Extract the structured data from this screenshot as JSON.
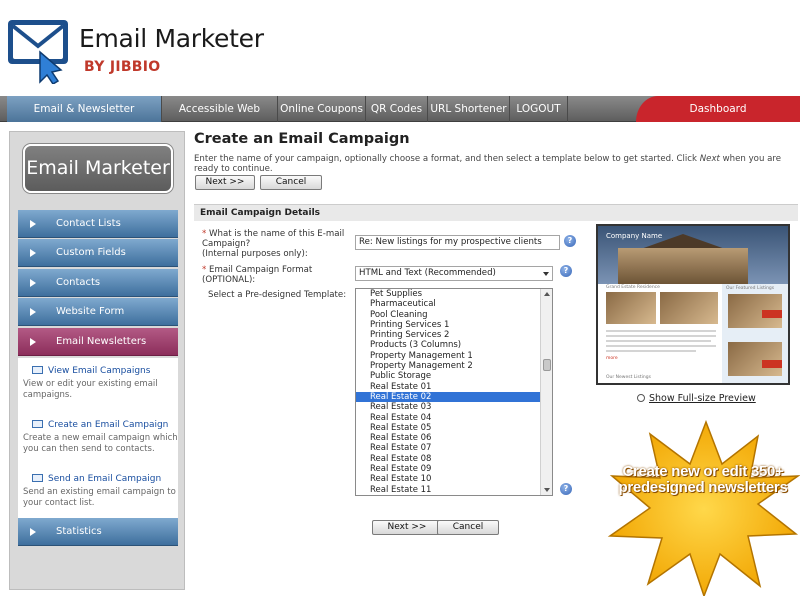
{
  "brand": {
    "title": "Email Marketer",
    "subtitle": "BY JIBBIO",
    "accent": "#c9252c"
  },
  "nav": {
    "items": [
      {
        "label": "Email & Newsletter Marketing",
        "active": true
      },
      {
        "label": "Accessible Web Forms"
      },
      {
        "label": "Online Coupons"
      },
      {
        "label": "QR Codes"
      },
      {
        "label": "URL Shortener"
      },
      {
        "label": "LOGOUT"
      }
    ],
    "dashboard": "Dashboard"
  },
  "sidebar": {
    "logo": "Email Marketer",
    "items": [
      "Contact Lists",
      "Custom Fields",
      "Contacts",
      "Website Form",
      "Email Newsletters"
    ],
    "sub": [
      {
        "label": "View Email Campaigns",
        "desc": "View or edit your existing email campaigns."
      },
      {
        "label": "Create an Email Campaign",
        "desc": "Create a new email campaign which you can then send to contacts."
      },
      {
        "label": "Send an Email Campaign",
        "desc": "Send an existing email campaign to your contact list."
      }
    ],
    "statistics": "Statistics"
  },
  "main": {
    "title": "Create an Email Campaign",
    "instructions_a": "Enter the name of your campaign, optionally choose a format, and then select a template below to get started. Click ",
    "instructions_em": "Next",
    "instructions_b": " when you are ready to continue.",
    "next": "Next >>",
    "cancel": "Cancel"
  },
  "details": {
    "heading": "Email Campaign Details",
    "name_label": "What is the name of this E-mail Campaign?",
    "name_note": "(Internal purposes only):",
    "name_value": "Re: New listings for my prospective clients",
    "format_label": "Email Campaign Format",
    "format_note": "(OPTIONAL):",
    "format_value": "HTML and Text (Recommended)",
    "template_label": "Select a Pre-designed Template:",
    "templates": [
      "Pet Supplies",
      "Pharmaceutical",
      "Pool Cleaning",
      "Printing Services 1",
      "Printing Services 2",
      "Products (3 Columns)",
      "Property Management 1",
      "Property Management 2",
      "Public Storage",
      "Real Estate 01",
      "Real Estate 02",
      "Real Estate 03",
      "Real Estate 04",
      "Real Estate 05",
      "Real Estate 06",
      "Real Estate 07",
      "Real Estate 08",
      "Real Estate 09",
      "Real Estate 10",
      "Real Estate 11"
    ],
    "selected_template": "Real Estate 02",
    "help": "?"
  },
  "preview": {
    "company": "Company Name",
    "headline": "Grand Estate Residence",
    "caption": "Our Featured Listings",
    "footer": "Our Newest Listings",
    "more": "more",
    "show_label": "Show Full-size Preview"
  },
  "promo": {
    "text": "Create new or edit 350+ predesigned newsletters"
  }
}
